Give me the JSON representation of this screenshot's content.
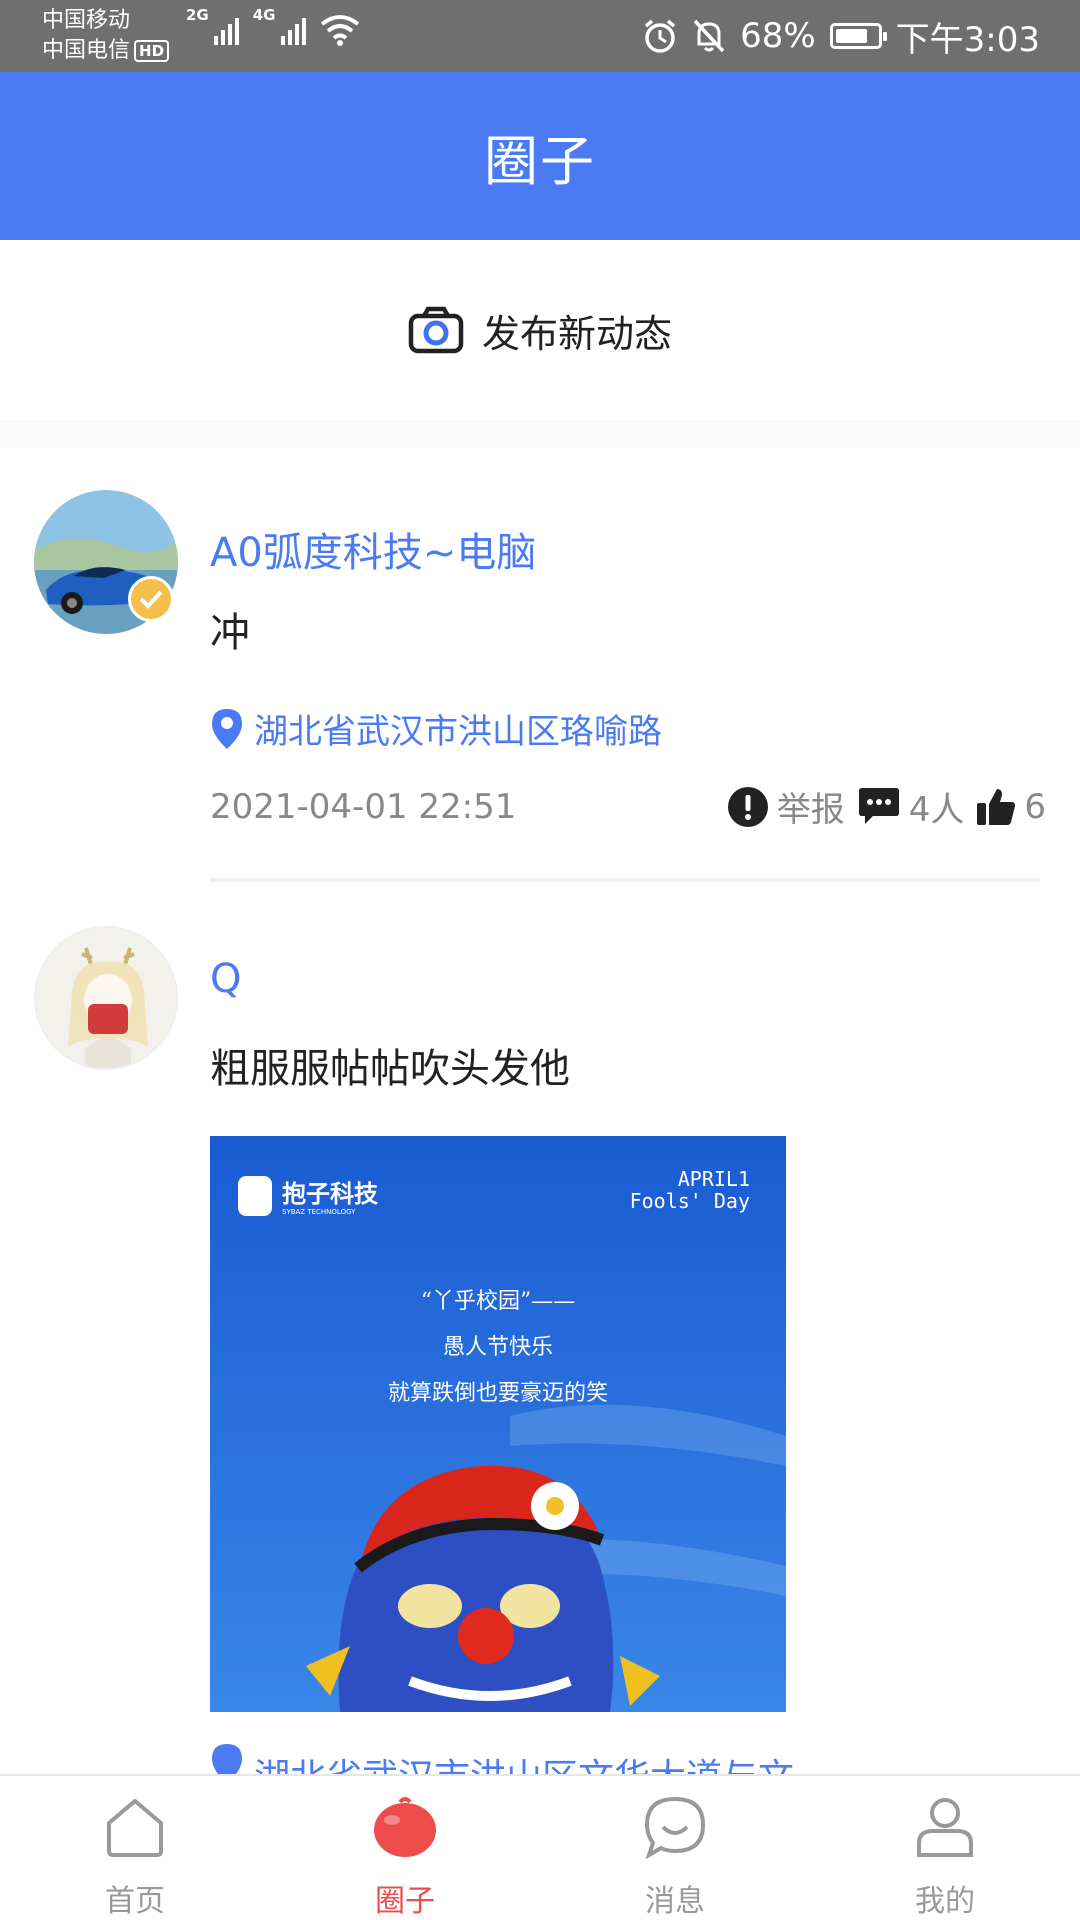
{
  "status_bar": {
    "carrier1": "中国移动",
    "carrier2": "中国电信",
    "hd": "HD",
    "net1": "2G",
    "net2": "4G",
    "battery": "68%",
    "battery_level": 0.68,
    "time": "下午3:03"
  },
  "header": {
    "title": "圈子"
  },
  "publish": {
    "label": "发布新动态",
    "icon": "camera-icon"
  },
  "posts": [
    {
      "author": "A0弧度科技~电脑",
      "text": "冲",
      "location": "湖北省武汉市洪山区珞喻路",
      "time": "2021-04-01 22:51",
      "report": "举报",
      "comments": "4人",
      "likes": "6",
      "verified": true
    },
    {
      "author": "Q",
      "text": "粗服服帖帖吹头发他",
      "location_partial": "湖北省武汉市洪山区文华大道与文",
      "image": {
        "brand": "抱子科技",
        "brand_sub": "SYBAZ TECHNOLOGY",
        "date1": "APRIL1",
        "date2": "Fools' Day",
        "line1": "“丫乎校园”——",
        "line2": "愚人节快乐",
        "line3": "就算跌倒也要豪迈的笑"
      }
    }
  ],
  "tabs": [
    {
      "label": "首页",
      "icon": "home-icon",
      "active": false
    },
    {
      "label": "圈子",
      "icon": "circle-icon",
      "active": true
    },
    {
      "label": "消息",
      "icon": "message-icon",
      "active": false
    },
    {
      "label": "我的",
      "icon": "profile-icon",
      "active": false
    }
  ],
  "colors": {
    "primary": "#4a7bf5",
    "active_tab": "#ee4b4b",
    "status_bar": "#6f6f6f"
  }
}
